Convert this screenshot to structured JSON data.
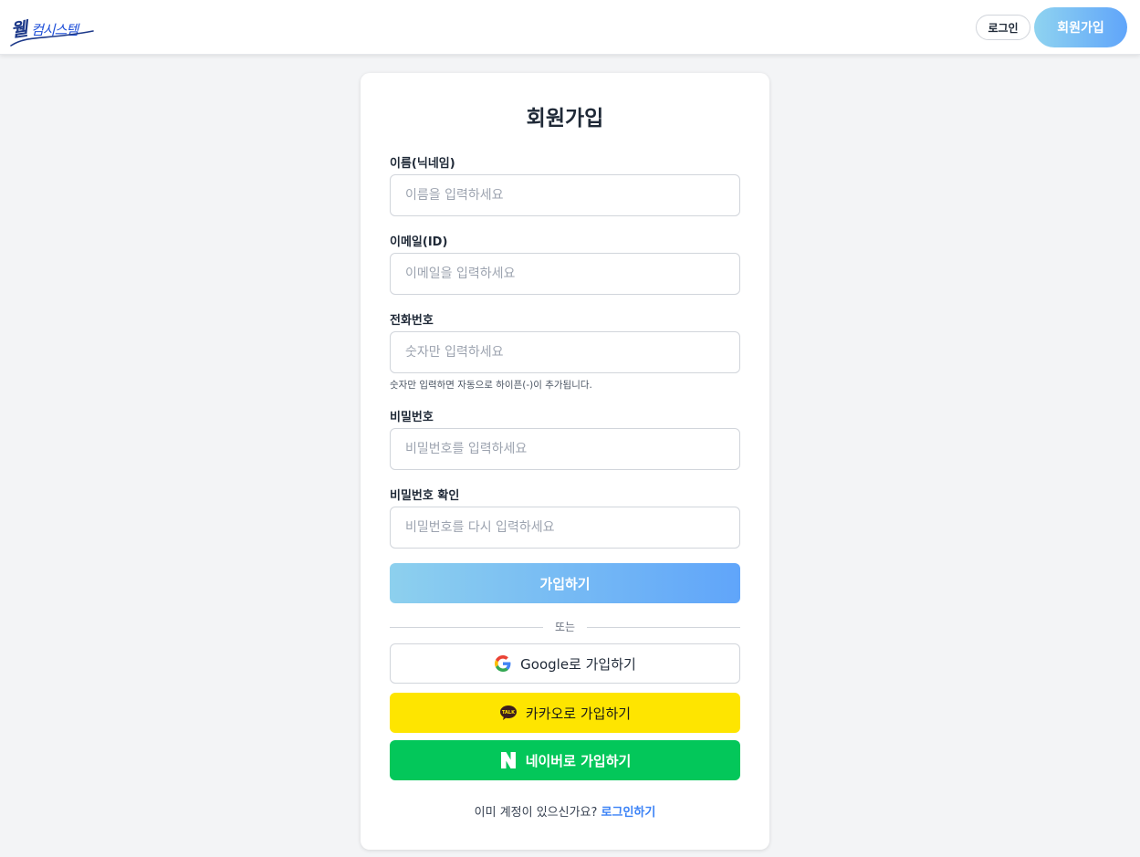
{
  "header": {
    "logo_text": "웰컴시스템",
    "login_label": "로그인",
    "signup_label": "회원가입"
  },
  "form": {
    "title": "회원가입",
    "fields": [
      {
        "label": "이름(닉네임)",
        "placeholder": "이름을 입력하세요",
        "value": ""
      },
      {
        "label": "이메일(ID)",
        "placeholder": "이메일을 입력하세요",
        "value": ""
      },
      {
        "label": "전화번호",
        "placeholder": "숫자만 입력하세요",
        "value": "",
        "hint": "숫자만 입력하면 자동으로 하이픈(-)이 추가됩니다."
      },
      {
        "label": "비밀번호",
        "placeholder": "비밀번호를 입력하세요",
        "value": ""
      },
      {
        "label": "비밀번호 확인",
        "placeholder": "비밀번호를 다시 입력하세요",
        "value": ""
      }
    ],
    "submit_label": "가입하기",
    "divider_text": "또는",
    "social": {
      "google_label": "Google로 가입하기",
      "kakao_label": "카카오로 가입하기",
      "naver_label": "네이버로 가입하기"
    },
    "footer_text": "이미 계정이 있으신가요?",
    "footer_link": "로그인하기"
  },
  "colors": {
    "accent_gradient_start": "#8dd0ee",
    "accent_gradient_end": "#60a5fa",
    "kakao_yellow": "#fee500",
    "naver_green": "#03c75a",
    "link_blue": "#3b82f6"
  }
}
